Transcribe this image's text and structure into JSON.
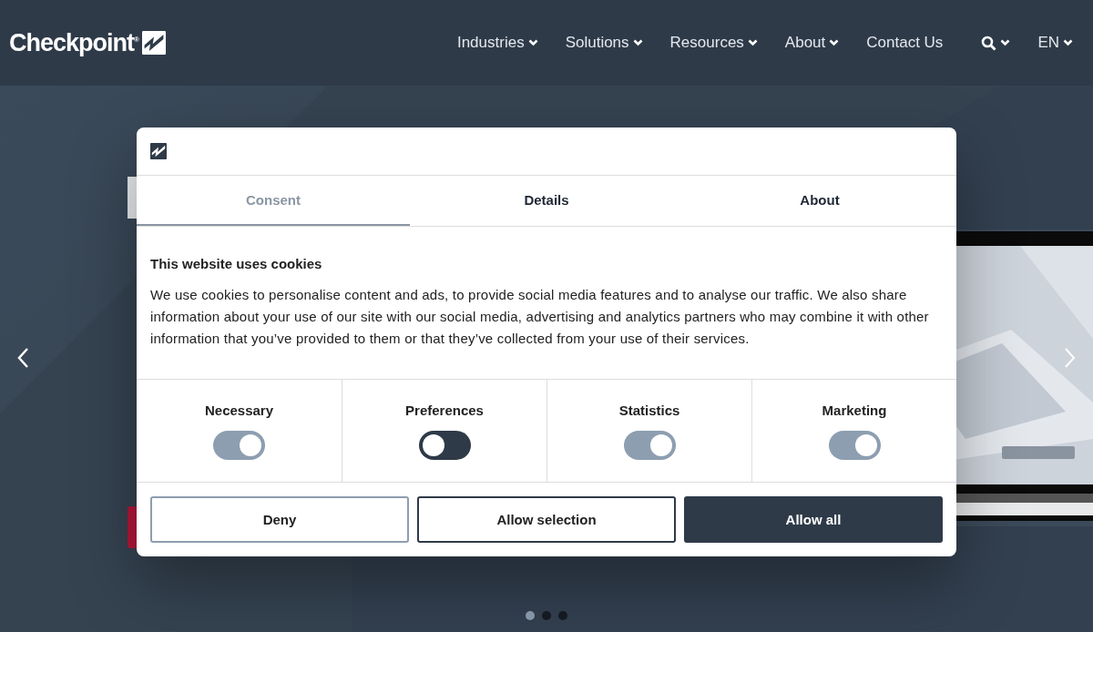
{
  "header": {
    "logo": "Checkpoint$^{®}$",
    "nav": [
      {
        "label": "Industries",
        "dropdown": true
      },
      {
        "label": "Solutions",
        "dropdown": true
      },
      {
        "label": "Resources",
        "dropdown": true
      },
      {
        "label": "About",
        "dropdown": true
      },
      {
        "label": "Contact Us",
        "dropdown": false
      }
    ],
    "language": "EN"
  },
  "hero": {
    "slides": [
      {
        "selected": true
      },
      {
        "selected": false
      },
      {
        "selected": false
      }
    ]
  },
  "consent": {
    "tabs": [
      {
        "label": "Consent",
        "selected": true
      },
      {
        "label": "Details",
        "selected": false
      },
      {
        "label": "About",
        "selected": false
      }
    ],
    "title": "This website uses cookies",
    "body": "We use cookies to personalise content and ads, to provide social media features and to analyse our traffic. We also share information about your use of our site with our social media, advertising and analytics partners who may combine it with other information that you’ve provided to them or that they’ve collected from your use of their services.",
    "categories": [
      {
        "label": "Necessary",
        "on": true
      },
      {
        "label": "Preferences",
        "on": false
      },
      {
        "label": "Statistics",
        "on": true
      },
      {
        "label": "Marketing",
        "on": true
      }
    ],
    "buttons": [
      {
        "label": "Deny",
        "kind": "outline"
      },
      {
        "label": "Allow selection",
        "kind": "outline-dark"
      },
      {
        "label": "Allow all",
        "kind": "solid"
      }
    ]
  }
}
